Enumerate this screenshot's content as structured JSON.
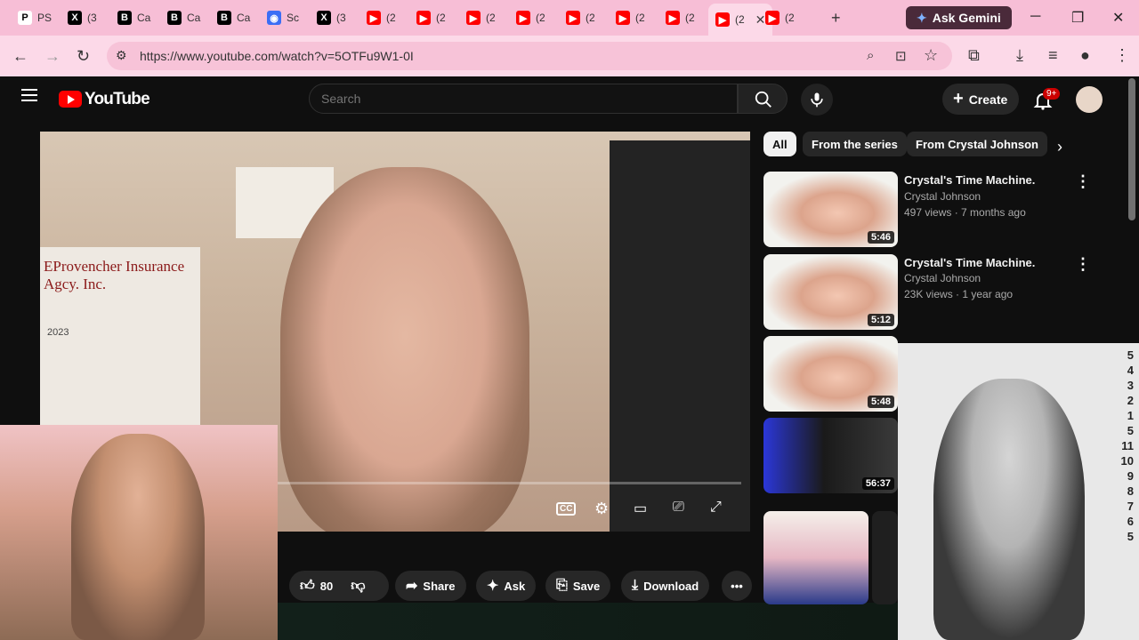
{
  "browser": {
    "tabs": [
      {
        "label": "PS",
        "icon": "P-icon",
        "color": "#ffffff"
      },
      {
        "label": "(3",
        "icon": "x-icon",
        "color": "#000000"
      },
      {
        "label": "Ca",
        "icon": "B-icon",
        "color": "#000000"
      },
      {
        "label": "Ca",
        "icon": "B-icon",
        "color": "#000000"
      },
      {
        "label": "Ca",
        "icon": "B-icon",
        "color": "#000000"
      },
      {
        "label": "Sc",
        "icon": "app-icon",
        "color": "#3b6ef5"
      },
      {
        "label": "(3",
        "icon": "x-icon",
        "color": "#000000"
      },
      {
        "label": "(2",
        "icon": "youtube-icon",
        "color": "#ff0000"
      },
      {
        "label": "(2",
        "icon": "youtube-icon",
        "color": "#ff0000"
      },
      {
        "label": "(2",
        "icon": "youtube-icon",
        "color": "#ff0000"
      },
      {
        "label": "(2",
        "icon": "youtube-icon",
        "color": "#ff0000"
      },
      {
        "label": "(2",
        "icon": "youtube-icon",
        "color": "#ff0000"
      },
      {
        "label": "(2",
        "icon": "youtube-icon",
        "color": "#ff0000"
      },
      {
        "label": "(2",
        "icon": "youtube-icon",
        "color": "#ff0000"
      },
      {
        "label": "(2",
        "icon": "youtube-icon",
        "color": "#ff0000",
        "active": true
      },
      {
        "label": "(2",
        "icon": "youtube-icon",
        "color": "#ff0000"
      }
    ],
    "gemini_label": "Ask Gemini",
    "url": "https://www.youtube.com/watch?v=5OTFu9W1-0I"
  },
  "youtube": {
    "brand": "YouTube",
    "search_placeholder": "Search",
    "create_label": "Create",
    "notification_count": "9+",
    "actions": {
      "like_count": "80",
      "share": "Share",
      "ask": "Ask",
      "save": "Save",
      "download": "Download"
    },
    "chips": [
      "All",
      "From the series",
      "From Crystal Johnson"
    ],
    "recommendations": [
      {
        "title": "Crystal's Time Machine.",
        "channel": "Crystal Johnson",
        "views": "497 views",
        "age": "7 months ago",
        "duration": "5:46"
      },
      {
        "title": "Crystal's Time Machine.",
        "channel": "Crystal Johnson",
        "views": "23K views",
        "age": "1 year ago",
        "duration": "5:12"
      },
      {
        "title": "",
        "channel": "",
        "views": "",
        "age": "",
        "duration": "5:48"
      },
      {
        "title": "",
        "channel": "",
        "views": "",
        "age": "",
        "duration": "56:37"
      }
    ],
    "player": {
      "calendar_year": "2023",
      "poster_text": "EProvencher Insurance Agcy. Inc."
    }
  },
  "overlay": {
    "height_scale": [
      "5",
      "4",
      "3",
      "2",
      "1",
      "5",
      "11",
      "10",
      "9",
      "8",
      "7",
      "6",
      "5"
    ]
  }
}
